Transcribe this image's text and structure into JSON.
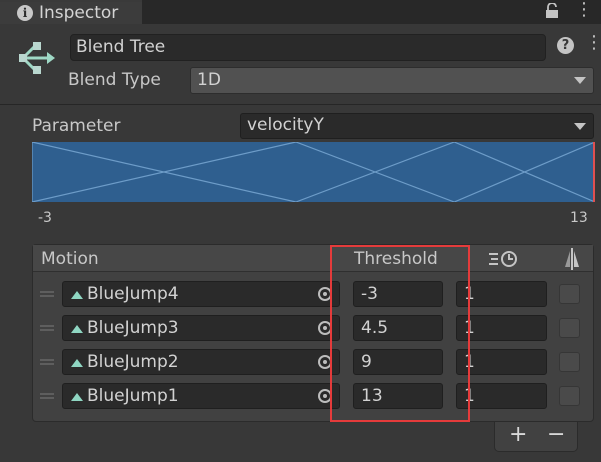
{
  "tab": {
    "title": "Inspector",
    "info_icon": "info-icon",
    "lock_icon": "lock-icon",
    "menu_icon": "kebab-menu-icon"
  },
  "header": {
    "name": "Blend Tree",
    "blend_type_label": "Blend Type",
    "blend_type_value": "1D",
    "icon": "blend-tree-icon"
  },
  "parameter": {
    "label": "Parameter",
    "value": "velocityY",
    "graph": {
      "min_label": "-3",
      "max_label": "13",
      "thresholds": [
        -3,
        4.5,
        9,
        13
      ],
      "fill_color": "#2f5f8f",
      "line_color": "#6d9cc8"
    }
  },
  "motion_table": {
    "columns": {
      "motion": "Motion",
      "threshold": "Threshold",
      "time_scale_icon": "time-scale-icon",
      "mirror_icon": "mirror-icon"
    },
    "rows": [
      {
        "motion": "BlueJump4",
        "threshold": "-3",
        "time_scale": "1"
      },
      {
        "motion": "BlueJump3",
        "threshold": "4.5",
        "time_scale": "1"
      },
      {
        "motion": "BlueJump2",
        "threshold": "9",
        "time_scale": "1"
      },
      {
        "motion": "BlueJump1",
        "threshold": "13",
        "time_scale": "1"
      }
    ],
    "add_label": "+",
    "remove_label": "−"
  },
  "colors": {
    "highlight": "#e53b3b",
    "background": "#383838"
  }
}
